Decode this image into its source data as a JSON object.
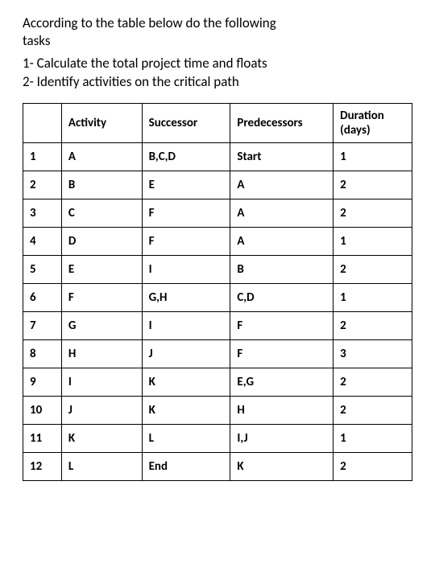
{
  "intro": "According to the table below do the following tasks",
  "tasks": {
    "t1": "1- Calculate the total project time and floats",
    "t2": "2- Identify activities on the critical path"
  },
  "headers": {
    "num": "",
    "activity": "Activity",
    "successor": "Successor",
    "predecessors": "Predecessors",
    "duration_line1": "Duration",
    "duration_line2": "(days)"
  },
  "rows": [
    {
      "num": "1",
      "activity": "A",
      "successor": "B,C,D",
      "predecessors": "Start",
      "duration": "1"
    },
    {
      "num": "2",
      "activity": "B",
      "successor": "E",
      "predecessors": "A",
      "duration": "2"
    },
    {
      "num": "3",
      "activity": "C",
      "successor": "F",
      "predecessors": "A",
      "duration": "2"
    },
    {
      "num": "4",
      "activity": "D",
      "successor": "F",
      "predecessors": "A",
      "duration": "1"
    },
    {
      "num": "5",
      "activity": "E",
      "successor": "I",
      "predecessors": "B",
      "duration": "2"
    },
    {
      "num": "6",
      "activity": "F",
      "successor": "G,H",
      "predecessors": "C,D",
      "duration": "1"
    },
    {
      "num": "7",
      "activity": "G",
      "successor": "I",
      "predecessors": "F",
      "duration": "2"
    },
    {
      "num": "8",
      "activity": "H",
      "successor": "J",
      "predecessors": "F",
      "duration": "3"
    },
    {
      "num": "9",
      "activity": "I",
      "successor": "K",
      "predecessors": "E,G",
      "duration": "2"
    },
    {
      "num": "10",
      "activity": "J",
      "successor": "K",
      "predecessors": "H",
      "duration": "2"
    },
    {
      "num": "11",
      "activity": "K",
      "successor": "L",
      "predecessors": "I,J",
      "duration": "1"
    },
    {
      "num": "12",
      "activity": "L",
      "successor": "End",
      "predecessors": "K",
      "duration": "2"
    }
  ]
}
